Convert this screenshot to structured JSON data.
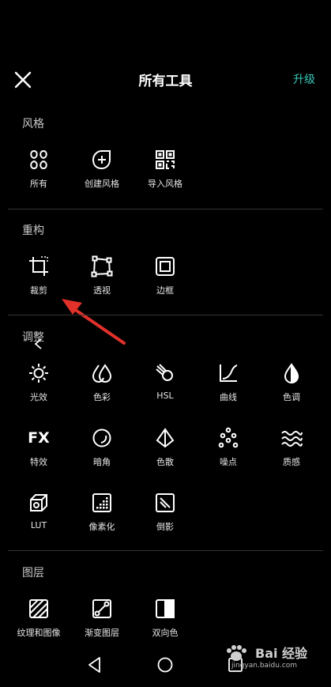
{
  "header": {
    "title": "所有工具",
    "upgrade_label": "升级"
  },
  "sections": {
    "style": {
      "title": "风格",
      "tools": [
        {
          "label": "所有",
          "icon": "grid-icon"
        },
        {
          "label": "创建风格",
          "icon": "create-style-icon"
        },
        {
          "label": "导入风格",
          "icon": "qr-import-icon"
        }
      ]
    },
    "restructure": {
      "title": "重构",
      "tools": [
        {
          "label": "裁剪",
          "icon": "crop-icon"
        },
        {
          "label": "透视",
          "icon": "perspective-icon"
        },
        {
          "label": "边框",
          "icon": "frame-icon"
        }
      ]
    },
    "adjust": {
      "title": "调整",
      "tools": [
        {
          "label": "光效",
          "icon": "sun-icon"
        },
        {
          "label": "色彩",
          "icon": "color-drops-icon"
        },
        {
          "label": "HSL",
          "icon": "hsl-icon"
        },
        {
          "label": "曲线",
          "icon": "curve-icon"
        },
        {
          "label": "色调",
          "icon": "tone-drop-icon"
        },
        {
          "label": "特效",
          "icon": "fx-icon",
          "glyph": "FX"
        },
        {
          "label": "暗角",
          "icon": "vignette-icon"
        },
        {
          "label": "色散",
          "icon": "prism-icon"
        },
        {
          "label": "噪点",
          "icon": "noise-dots-icon"
        },
        {
          "label": "质感",
          "icon": "texture-waves-icon"
        },
        {
          "label": "LUT",
          "icon": "lut-cube-icon"
        },
        {
          "label": "像素化",
          "icon": "pixelate-icon"
        },
        {
          "label": "倒影",
          "icon": "reflection-icon"
        }
      ]
    },
    "layers": {
      "title": "图层",
      "tools": [
        {
          "label": "纹理和图像",
          "icon": "texture-image-icon"
        },
        {
          "label": "渐变图层",
          "icon": "gradient-layer-icon"
        },
        {
          "label": "双向色",
          "icon": "duotone-icon"
        }
      ]
    }
  },
  "watermark": {
    "text": "Bai 经验",
    "url_text": "jingyan.baidu.com"
  },
  "colors": {
    "accent": "#37c8b8",
    "arrow": "#e2312b",
    "background": "#000000"
  }
}
